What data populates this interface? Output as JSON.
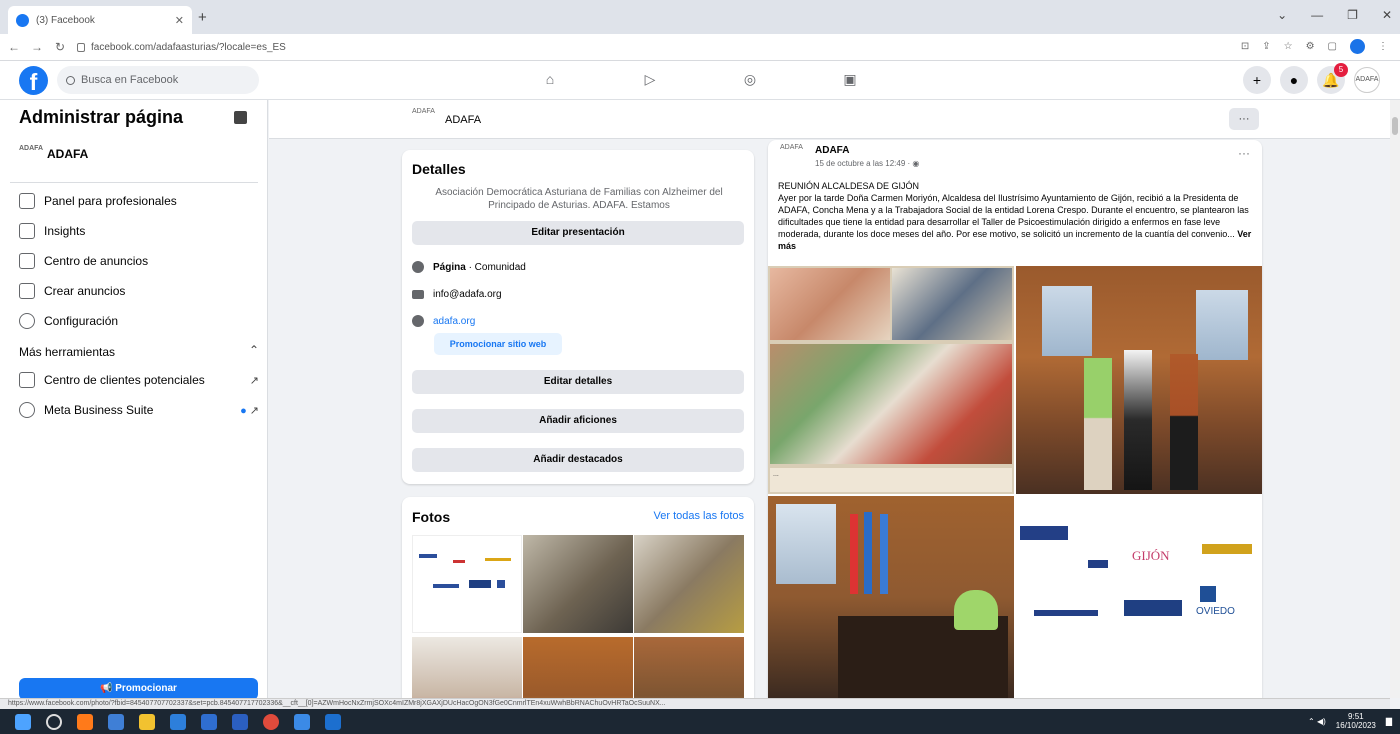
{
  "browser": {
    "tab_title": "(3) Facebook",
    "url": "facebook.com/adafaasturias/?locale=es_ES",
    "status_url": "https://www.facebook.com/photo/?fbid=845407707702337&set=pcb.845407717702336&__cft__[0]=AZWmHocNxZrmjSOXc4mIZMr8jXGAXjDUcHacOgON3fGe0CnmrlTEn4xuWwhBbRNAChuOvHRTaOcSuuNX...",
    "colors": {
      "fb_blue": "#1877f2",
      "badge_red": "#e41e3f",
      "page_bg": "#f0f2f5"
    }
  },
  "topbar": {
    "search_placeholder": "Busca en Facebook",
    "notifications_count": "5",
    "nav_icons": [
      "home-icon",
      "watch-icon",
      "groups-icon",
      "gaming-icon"
    ]
  },
  "sidebar": {
    "title": "Administrar página",
    "page_name": "ADAFA",
    "items": [
      {
        "label": "Panel para profesionales",
        "icon": "dashboard-icon"
      },
      {
        "label": "Insights",
        "icon": "insights-icon"
      },
      {
        "label": "Centro de anuncios",
        "icon": "megaphone-icon"
      },
      {
        "label": "Crear anuncios",
        "icon": "pencil-icon"
      },
      {
        "label": "Configuración",
        "icon": "gear-icon"
      }
    ],
    "more_tools_label": "Más herramientas",
    "tools": [
      {
        "label": "Centro de clientes potenciales",
        "icon": "leads-icon"
      },
      {
        "label": "Meta Business Suite",
        "icon": "meta-icon"
      }
    ],
    "promote_label": "Promocionar"
  },
  "page_strip": {
    "name": "ADAFA",
    "more_label": "···"
  },
  "details": {
    "title": "Detalles",
    "description": "Asociación Democrática Asturiana de Familias con Alzheimer del Principado de Asturias. ADAFA. Estamos",
    "edit_presentation": "Editar presentación",
    "category_bold": "Página",
    "category_rest": " · Comunidad",
    "email": "info@adafa.org",
    "website": "adafa.org",
    "promote_website": "Promocionar sitio web",
    "edit_details": "Editar detalles",
    "add_hobbies": "Añadir aficiones",
    "add_featured": "Añadir destacados"
  },
  "photos": {
    "title": "Fotos",
    "see_all": "Ver todas las fotos"
  },
  "post": {
    "author": "ADAFA",
    "time": "15 de octubre a las 12:49 · ",
    "more": "···",
    "heading": "REUNIÓN ALCALDESA DE GIJÓN",
    "body": "Ayer por la tarde Doña Carmen Moriyón, Alcaldesa del Ilustrísimo Ayuntamiento de Gijón, recibió a la Presidenta de ADAFA, Concha Mena y a la Trabajadora Social de la entidad Lorena Crespo. Durante el encuentro, se plantearon las dificultades que tiene la entidad para desarrollar el Taller de Psicoestimulación dirigido a enfermos en fase leve moderada, durante los doce meses del año. Por ese motivo, se solicitó un incremento de la cuantía del convenio... ",
    "see_more": "Ver más",
    "logo_texts": [
      "GIJÓN",
      "OVIEDO"
    ]
  },
  "taskbar": {
    "time": "9:51",
    "date": "16/10/2023"
  }
}
